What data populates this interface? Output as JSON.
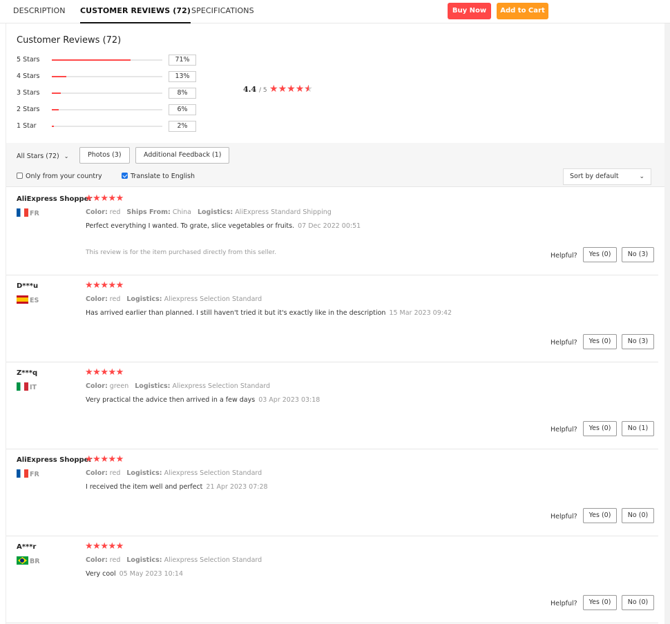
{
  "tabs": [
    {
      "label": "DESCRIPTION",
      "active": false
    },
    {
      "label": "CUSTOMER REVIEWS (72)",
      "active": true
    },
    {
      "label": "SPECIFICATIONS",
      "active": false
    }
  ],
  "actions": {
    "buy_now": "Buy Now",
    "add_to_cart": "Add to Cart"
  },
  "colors": {
    "accent_red": "#ff4747",
    "accent_orange": "#ff9a1e",
    "checkbox_blue": "#1a73e8"
  },
  "summary": {
    "title": "Customer Reviews (72)",
    "distribution": [
      {
        "label": "5 Stars",
        "percent_text": "71%",
        "fraction": 0.71
      },
      {
        "label": "4 Stars",
        "percent_text": "13%",
        "fraction": 0.13
      },
      {
        "label": "3 Stars",
        "percent_text": "8%",
        "fraction": 0.08
      },
      {
        "label": "2 Stars",
        "percent_text": "6%",
        "fraction": 0.06
      },
      {
        "label": "1 Star",
        "percent_text": "2%",
        "fraction": 0.02
      }
    ],
    "average": "4.4",
    "out_of": "/ 5",
    "average_stars": 4.5
  },
  "filters": {
    "all_stars": "All Stars (72)",
    "photos": "Photos (3)",
    "additional_feedback": "Additional Feedback (1)",
    "only_country": {
      "label": "Only from your country",
      "checked": false
    },
    "translate": {
      "label": "Translate to English",
      "checked": true
    },
    "sort": "Sort by default"
  },
  "helpful_label": "Helpful?",
  "reviews": [
    {
      "name": "AliExpress Shopper",
      "country": "FR",
      "flag": "fr",
      "stars": 5,
      "meta": [
        {
          "k": "Color:",
          "v": "red"
        },
        {
          "k": "Ships From:",
          "v": "China"
        },
        {
          "k": "Logistics:",
          "v": "AliExpress Standard Shipping"
        }
      ],
      "text": "Perfect everything I wanted. To grate, slice vegetables or fruits.",
      "date": "07 Dec 2022 00:51",
      "note": "This review is for the item purchased directly from this seller.",
      "yes": "Yes (0)",
      "no": "No (3)"
    },
    {
      "name": "D***u",
      "country": "ES",
      "flag": "es",
      "stars": 5,
      "meta": [
        {
          "k": "Color:",
          "v": "red"
        },
        {
          "k": "Logistics:",
          "v": "Aliexpress Selection Standard"
        }
      ],
      "text": "Has arrived earlier than planned. I still haven't tried it but it's exactly like in the description",
      "date": "15 Mar 2023 09:42",
      "note": "",
      "yes": "Yes (0)",
      "no": "No (3)"
    },
    {
      "name": "Z***q",
      "country": "IT",
      "flag": "it",
      "stars": 5,
      "meta": [
        {
          "k": "Color:",
          "v": "green"
        },
        {
          "k": "Logistics:",
          "v": "Aliexpress Selection Standard"
        }
      ],
      "text": "Very practical the advice then arrived in a few days",
      "date": "03 Apr 2023 03:18",
      "note": "",
      "yes": "Yes (0)",
      "no": "No (1)"
    },
    {
      "name": "AliExpress Shopper",
      "country": "FR",
      "flag": "fr",
      "stars": 5,
      "meta": [
        {
          "k": "Color:",
          "v": "red"
        },
        {
          "k": "Logistics:",
          "v": "Aliexpress Selection Standard"
        }
      ],
      "text": "I received the item well and perfect",
      "date": "21 Apr 2023 07:28",
      "note": "",
      "yes": "Yes (0)",
      "no": "No (0)"
    },
    {
      "name": "A***r",
      "country": "BR",
      "flag": "br",
      "stars": 5,
      "meta": [
        {
          "k": "Color:",
          "v": "red"
        },
        {
          "k": "Logistics:",
          "v": "Aliexpress Selection Standard"
        }
      ],
      "text": "Very cool",
      "date": "05 May 2023 10:14",
      "note": "",
      "yes": "Yes (0)",
      "no": "No (0)"
    }
  ]
}
